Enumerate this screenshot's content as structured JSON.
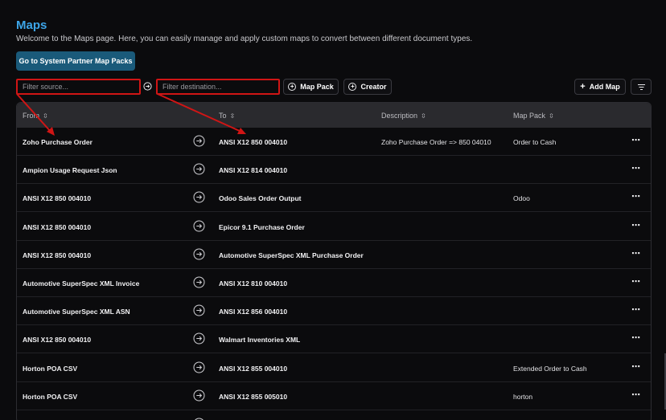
{
  "page": {
    "title": "Maps",
    "subtitle": "Welcome to the Maps page. Here, you can easily manage and apply custom maps to convert between different document types.",
    "partner_button": "Go to System Partner Map Packs"
  },
  "toolbar": {
    "source_placeholder": "Filter source...",
    "destination_placeholder": "Filter destination...",
    "map_pack_label": "Map Pack",
    "creator_label": "Creator",
    "add_map_label": "Add Map"
  },
  "table": {
    "headers": {
      "from": "From",
      "to": "To",
      "description": "Description",
      "map_pack": "Map Pack"
    },
    "rows": [
      {
        "from": "Zoho Purchase Order",
        "to": "ANSI X12 850 004010",
        "description": "Zoho Purchase Order => 850 04010",
        "map_pack": "Order to Cash"
      },
      {
        "from": "Ampion Usage Request Json",
        "to": "ANSI X12 814 004010",
        "description": "",
        "map_pack": ""
      },
      {
        "from": "ANSI X12 850 004010",
        "to": "Odoo Sales Order Output",
        "description": "",
        "map_pack": "Odoo"
      },
      {
        "from": "ANSI X12 850 004010",
        "to": "Epicor 9.1 Purchase Order",
        "description": "",
        "map_pack": ""
      },
      {
        "from": "ANSI X12 850 004010",
        "to": "Automotive SuperSpec XML Purchase Order",
        "description": "",
        "map_pack": ""
      },
      {
        "from": "Automotive SuperSpec XML Invoice",
        "to": "ANSI X12 810 004010",
        "description": "",
        "map_pack": ""
      },
      {
        "from": "Automotive SuperSpec XML ASN",
        "to": "ANSI X12 856 004010",
        "description": "",
        "map_pack": ""
      },
      {
        "from": "ANSI X12 850 004010",
        "to": "Walmart Inventories XML",
        "description": "",
        "map_pack": ""
      },
      {
        "from": "Horton POA CSV",
        "to": "ANSI X12 855 004010",
        "description": "",
        "map_pack": "Extended Order to Cash"
      },
      {
        "from": "Horton POA CSV",
        "to": "ANSI X12 855 005010",
        "description": "",
        "map_pack": "horton"
      },
      {
        "from": "",
        "to": "",
        "description": "",
        "map_pack": ""
      }
    ]
  },
  "colors": {
    "accent": "#3da5e8",
    "annotation": "#d01515"
  }
}
